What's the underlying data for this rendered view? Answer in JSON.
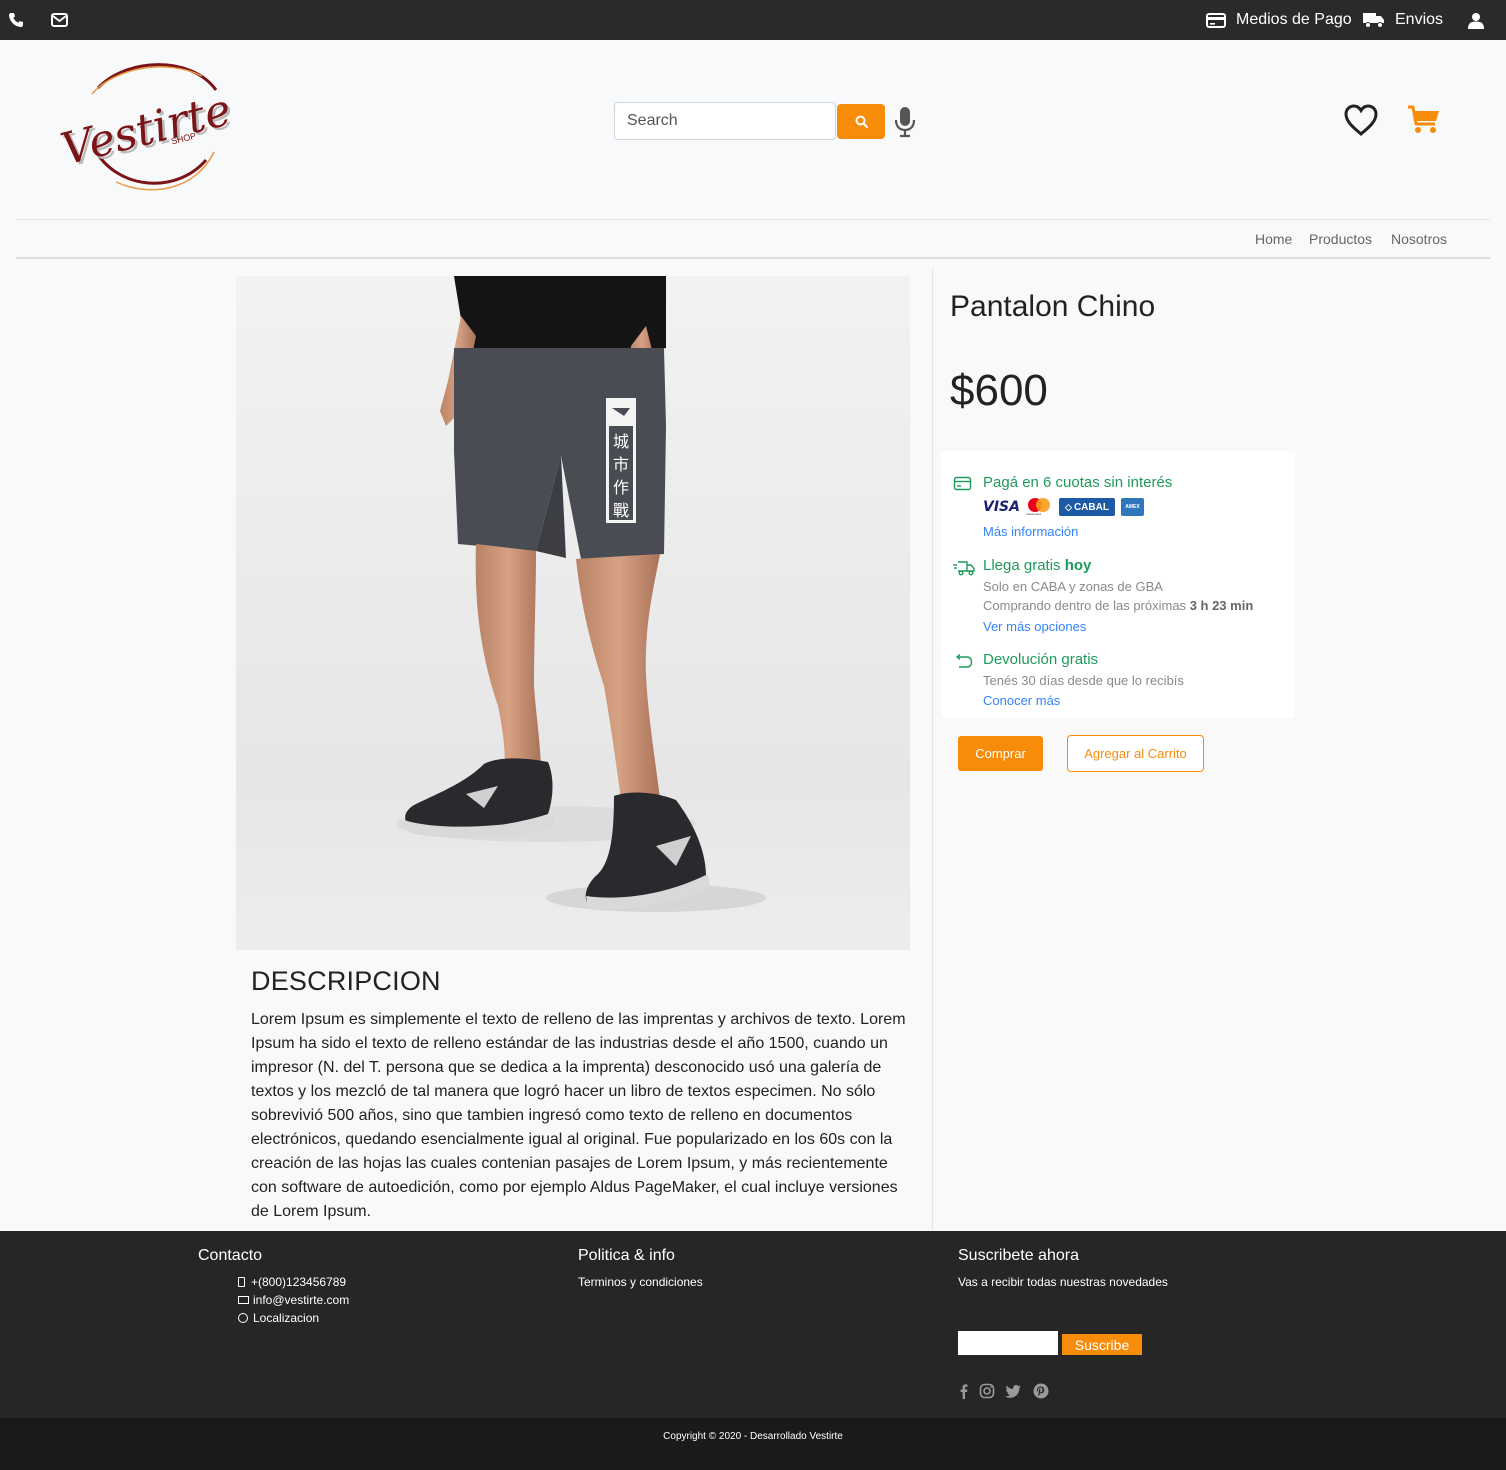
{
  "topbar": {
    "phone_icon": "phone-icon",
    "mail_icon": "envelope-icon",
    "payment_label": "Medios de Pago",
    "shipping_label": "Envios",
    "user_icon": "user-icon"
  },
  "header": {
    "logo_text": "Vestirte",
    "logo_sub": "SHOP",
    "search_placeholder": "Search",
    "search_value": ""
  },
  "nav": {
    "items": [
      "Home",
      "Productos",
      "Nosotros"
    ]
  },
  "product": {
    "title": "Pantalon Chino",
    "price": "$600",
    "installments_title": "Pagá en 6 cuotas sin interés",
    "card_brands": [
      "VISA",
      "mastercard",
      "CABAL",
      "AMEX"
    ],
    "installments_link": "Más información",
    "shipping_title": "Llega gratis",
    "shipping_highlight": "hoy",
    "shipping_sub": "Solo en CABA y zonas de GBA",
    "shipping_time_prefix": "Comprando dentro de las próximas",
    "shipping_time": "3 h 23 min",
    "shipping_link": "Ver más opciones",
    "return_title": "Devolución gratis",
    "return_sub": "Tenés 30 días desde que lo recibís",
    "return_link": "Conocer más",
    "buy_label": "Comprar",
    "add_cart_label": "Agregar al Carrito",
    "description_title": "DESCRIPCION",
    "description_text": "Lorem Ipsum es simplemente el texto de relleno de las imprentas y archivos de texto. Lorem Ipsum ha sido el texto de relleno estándar de las industrias desde el año 1500, cuando un impresor (N. del T. persona que se dedica a la imprenta) desconocido usó una galería de textos y los mezcló de tal manera que logró hacer un libro de textos especimen. No sólo sobrevivió 500 años, sino que tambien ingresó como texto de relleno en documentos electrónicos, quedando esencialmente igual al original. Fue popularizado en los 60s con la creación de las hojas las cuales contenian pasajes de Lorem Ipsum, y más recientemente con software de autoedición, como por ejemplo Aldus PageMaker, el cual incluye versiones de Lorem Ipsum.",
    "shorts_print": [
      "城",
      "市",
      "作",
      "戰"
    ]
  },
  "footer": {
    "contact_title": "Contacto",
    "phone": "+(800)123456789",
    "email": "info@vestirte.com",
    "location": "Localizacion",
    "policy_title": "Politica & info",
    "terms": "Terminos y condiciones",
    "subscribe_title": "Suscribete ahora",
    "subscribe_text": "Vas a recibir todas nuestras novedades",
    "subscribe_value": "",
    "subscribe_button": "Suscribe",
    "social_icons": [
      "facebook-icon",
      "instagram-icon",
      "twitter-icon",
      "pinterest-icon"
    ],
    "copyright": "Copyright © 2020 - Desarrollado Vestirte"
  },
  "colors": {
    "accent": "#f78c0b",
    "topbar": "#2a2a2a",
    "footer": "#262626",
    "green": "#1f9a5a",
    "link": "#3483fa",
    "logo_red": "#7a1416"
  }
}
